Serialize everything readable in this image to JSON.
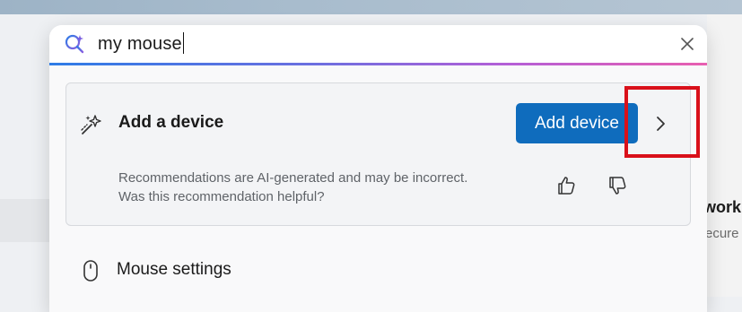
{
  "search": {
    "query": "my mouse",
    "close_icon": "close-icon",
    "copilot_icon": "copilot-search-icon"
  },
  "recommendation": {
    "icon": "sparkle-wand-icon",
    "title": "Add a device",
    "button_label": "Add device",
    "chevron_icon": "chevron-right-icon",
    "disclaimer_line1": "Recommendations are AI-generated and may be incorrect.",
    "disclaimer_line2": "Was this recommendation helpful?",
    "feedback_icons": [
      "thumbs-up-icon",
      "thumbs-down-icon"
    ]
  },
  "results": [
    {
      "icon": "mouse-icon",
      "label": "Mouse settings"
    }
  ],
  "background": {
    "right_heading": "work",
    "right_sub": "ecure"
  },
  "colors": {
    "accent_button": "#0f6cbd",
    "highlight_box": "#d9101a",
    "gradient": [
      "#2e7ce6",
      "#b55fd6",
      "#e85fb0"
    ]
  }
}
